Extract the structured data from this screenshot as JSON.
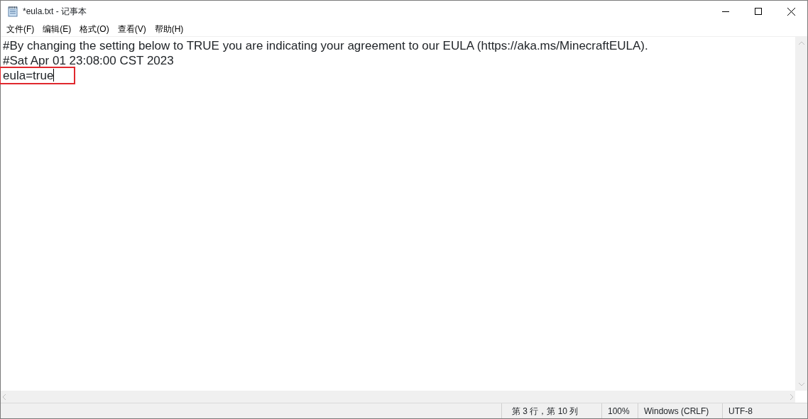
{
  "window": {
    "title": "*eula.txt - 记事本"
  },
  "menu": [
    "文件(F)",
    "编辑(E)",
    "格式(O)",
    "查看(V)",
    "帮助(H)"
  ],
  "lines": [
    {
      "text": "#By changing the setting below to TRUE you are indicating your agreement to our EULA (https://aka.ms/MinecraftEULA).",
      "highlighted": false,
      "caret": false
    },
    {
      "text": "#Sat Apr 01 23:08:00 CST 2023",
      "highlighted": false,
      "caret": false
    },
    {
      "text": "eula=true",
      "highlighted": true,
      "caret": true
    }
  ],
  "status_bar": {
    "position": "第 3 行，第 10 列",
    "zoom": "100%",
    "line_ending": "Windows (CRLF)",
    "encoding": "UTF-8"
  }
}
